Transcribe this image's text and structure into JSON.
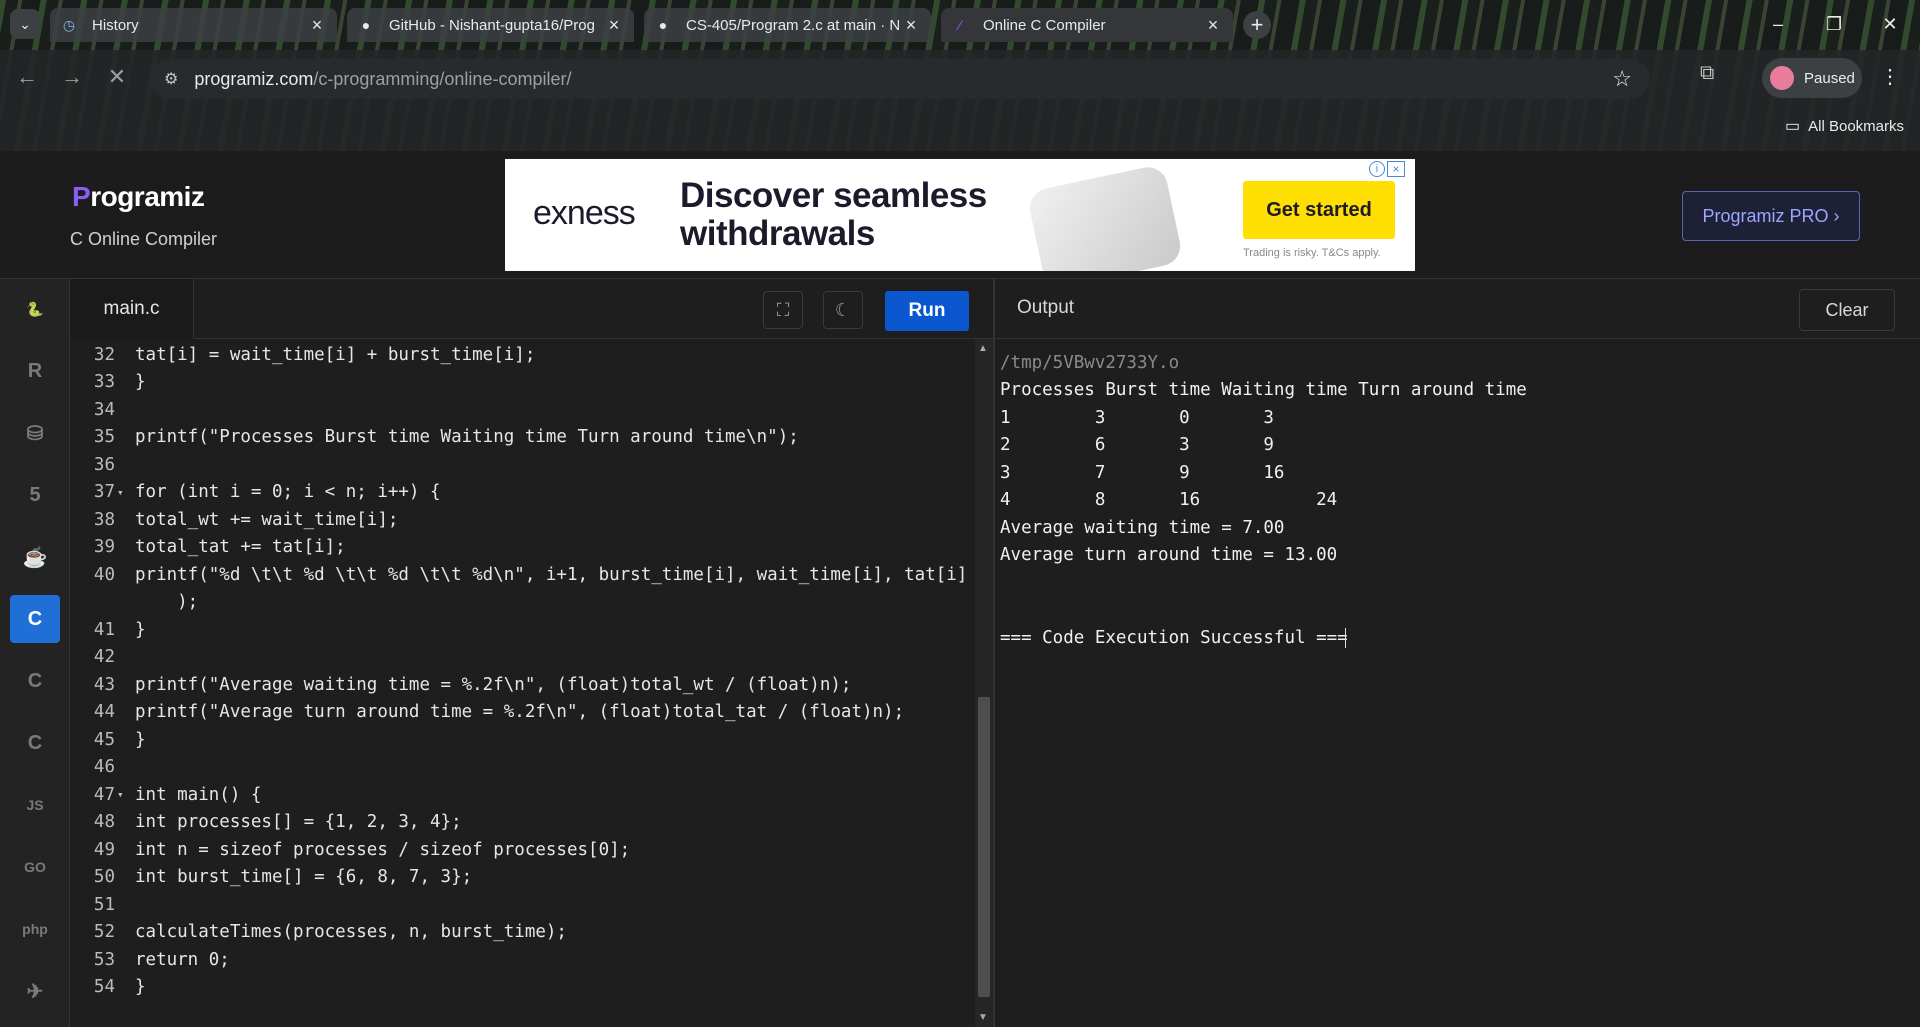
{
  "browser": {
    "tabs": [
      {
        "title": "History",
        "icon": "history-icon",
        "active": false
      },
      {
        "title": "GitHub - Nishant-gupta16/Prog",
        "icon": "github-icon",
        "active": false
      },
      {
        "title": "CS-405/Program 2.c at main · N",
        "icon": "github-icon",
        "active": false
      },
      {
        "title": "Online C Compiler",
        "icon": "programiz-icon",
        "active": true
      }
    ],
    "url_host": "programiz.com",
    "url_path": "/c-programming/online-compiler/",
    "profile_label": "Paused",
    "bookmarks_label": "All Bookmarks"
  },
  "site": {
    "logo_text": "rogramiz",
    "subtitle": "C Online Compiler",
    "pro_button": "Programiz PRO ›",
    "ad": {
      "brand": "exness",
      "headline_1": "Discover seamless",
      "headline_2": "withdrawals",
      "cta": "Get started",
      "note": "Trading is risky. T&Cs apply."
    }
  },
  "languages": [
    {
      "name": "Python",
      "icon": "python-icon",
      "glyph": "🐍",
      "active": false
    },
    {
      "name": "R",
      "icon": "r-icon",
      "glyph": "R",
      "active": false
    },
    {
      "name": "SQL",
      "icon": "database-icon",
      "glyph": "⛁",
      "active": false
    },
    {
      "name": "HTML",
      "icon": "html5-icon",
      "glyph": "5",
      "active": false
    },
    {
      "name": "Java",
      "icon": "java-icon",
      "glyph": "☕",
      "active": false
    },
    {
      "name": "C",
      "icon": "c-icon",
      "glyph": "C",
      "active": true
    },
    {
      "name": "C++",
      "icon": "cpp-icon",
      "glyph": "C",
      "active": false
    },
    {
      "name": "C#",
      "icon": "csharp-icon",
      "glyph": "C",
      "active": false
    },
    {
      "name": "JS",
      "icon": "javascript-icon",
      "glyph": "JS",
      "active": false
    },
    {
      "name": "Go",
      "icon": "go-icon",
      "glyph": "GO",
      "active": false
    },
    {
      "name": "PHP",
      "icon": "php-icon",
      "glyph": "php",
      "active": false
    },
    {
      "name": "Swift",
      "icon": "swift-icon",
      "glyph": "✈",
      "active": false
    }
  ],
  "editor": {
    "filename": "main.c",
    "run_label": "Run",
    "lines": [
      {
        "n": "32",
        "fold": false,
        "text": "tat[i] = wait_time[i] + burst_time[i];"
      },
      {
        "n": "33",
        "fold": false,
        "text": "}"
      },
      {
        "n": "34",
        "fold": false,
        "text": ""
      },
      {
        "n": "35",
        "fold": false,
        "text": "printf(\"Processes Burst time Waiting time Turn around time\\n\");"
      },
      {
        "n": "36",
        "fold": false,
        "text": ""
      },
      {
        "n": "37",
        "fold": true,
        "text": "for (int i = 0; i < n; i++) {"
      },
      {
        "n": "38",
        "fold": false,
        "text": "total_wt += wait_time[i];"
      },
      {
        "n": "39",
        "fold": false,
        "text": "total_tat += tat[i];"
      },
      {
        "n": "40",
        "fold": false,
        "text": "printf(\"%d \\t\\t %d \\t\\t %d \\t\\t %d\\n\", i+1, burst_time[i], wait_time[i], tat[i]"
      },
      {
        "n": "",
        "fold": false,
        "text": "    );"
      },
      {
        "n": "41",
        "fold": false,
        "text": "}"
      },
      {
        "n": "42",
        "fold": false,
        "text": ""
      },
      {
        "n": "43",
        "fold": false,
        "text": "printf(\"Average waiting time = %.2f\\n\", (float)total_wt / (float)n);"
      },
      {
        "n": "44",
        "fold": false,
        "text": "printf(\"Average turn around time = %.2f\\n\", (float)total_tat / (float)n);"
      },
      {
        "n": "45",
        "fold": false,
        "text": "}"
      },
      {
        "n": "46",
        "fold": false,
        "text": ""
      },
      {
        "n": "47",
        "fold": true,
        "text": "int main() {"
      },
      {
        "n": "48",
        "fold": false,
        "text": "int processes[] = {1, 2, 3, 4};"
      },
      {
        "n": "49",
        "fold": false,
        "text": "int n = sizeof processes / sizeof processes[0];"
      },
      {
        "n": "50",
        "fold": false,
        "text": "int burst_time[] = {6, 8, 7, 3};"
      },
      {
        "n": "51",
        "fold": false,
        "text": ""
      },
      {
        "n": "52",
        "fold": false,
        "text": "calculateTimes(processes, n, burst_time);"
      },
      {
        "n": "53",
        "fold": false,
        "text": "return 0;"
      },
      {
        "n": "54",
        "fold": false,
        "text": "}"
      }
    ]
  },
  "output": {
    "title": "Output",
    "clear_label": "Clear",
    "lines": [
      {
        "text": "/tmp/5VBwv2733Y.o",
        "kind": "path"
      },
      {
        "text": "Processes Burst time Waiting time Turn around time",
        "kind": "out"
      },
      {
        "text": "1        3       0       3",
        "kind": "out"
      },
      {
        "text": "2        6       3       9",
        "kind": "out"
      },
      {
        "text": "3        7       9       16",
        "kind": "out"
      },
      {
        "text": "4        8       16           24",
        "kind": "out"
      },
      {
        "text": "Average waiting time = 7.00",
        "kind": "out"
      },
      {
        "text": "Average turn around time = 13.00",
        "kind": "out"
      },
      {
        "text": "",
        "kind": "out"
      },
      {
        "text": "",
        "kind": "out"
      },
      {
        "text": "=== Code Execution Successful ===",
        "kind": "out"
      }
    ]
  }
}
